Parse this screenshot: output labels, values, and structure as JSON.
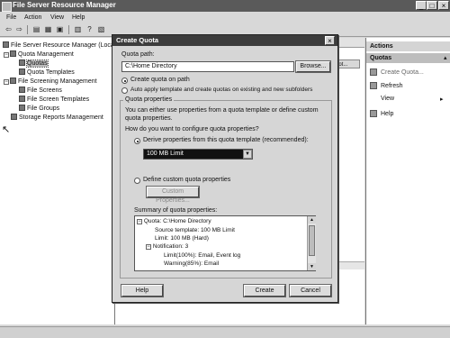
{
  "window": {
    "title": "File Server Resource Manager",
    "menu": [
      "File",
      "Action",
      "View",
      "Help"
    ]
  },
  "tree": {
    "items": [
      {
        "label": "File Server Resource Manager (Loca",
        "level": 0
      },
      {
        "label": "Quota Management",
        "level": 1
      },
      {
        "label": "Quotas",
        "level": 2,
        "selected": true
      },
      {
        "label": "Quota Templates",
        "level": 2
      },
      {
        "label": "File Screening Management",
        "level": 1
      },
      {
        "label": "File Screens",
        "level": 2
      },
      {
        "label": "File Screen Templates",
        "level": 2
      },
      {
        "label": "File Groups",
        "level": 2
      },
      {
        "label": "Storage Reports Management",
        "level": 1
      }
    ]
  },
  "list": {
    "column_header": "uot..."
  },
  "actions": {
    "header": "Actions",
    "section": "Quotas",
    "items": [
      "Create Quota...",
      "Refresh",
      "View",
      "Help"
    ]
  },
  "dialog": {
    "title": "Create Quota",
    "quota_path_label": "Quota path:",
    "quota_path_value": "C:\\Home Directory",
    "browse_label": "Browse...",
    "radio_create": "Create quota on path",
    "radio_auto": "Auto apply template and create quotas on existing and new subfolders",
    "group_title": "Quota properties",
    "group_desc": "You can either use properties from a quota template or define custom quota properties.",
    "question": "How do you want to configure quota properties?",
    "radio_derive": "Derive properties from this quota template (recommended):",
    "template_value": "100 MB Limit",
    "radio_custom": "Define custom quota properties",
    "custom_button": "Custom Properties...",
    "summary_label": "Summary of quota properties:",
    "summary": [
      "Quota: C:\\Home Directory",
      "Source template: 100 MB Limit",
      "Limit: 100 MB (Hard)",
      "Notification: 3",
      "Limit(100%): Email, Event log",
      "Warning(85%): Email"
    ],
    "help_label": "Help",
    "create_label": "Create",
    "cancel_label": "Cancel"
  }
}
